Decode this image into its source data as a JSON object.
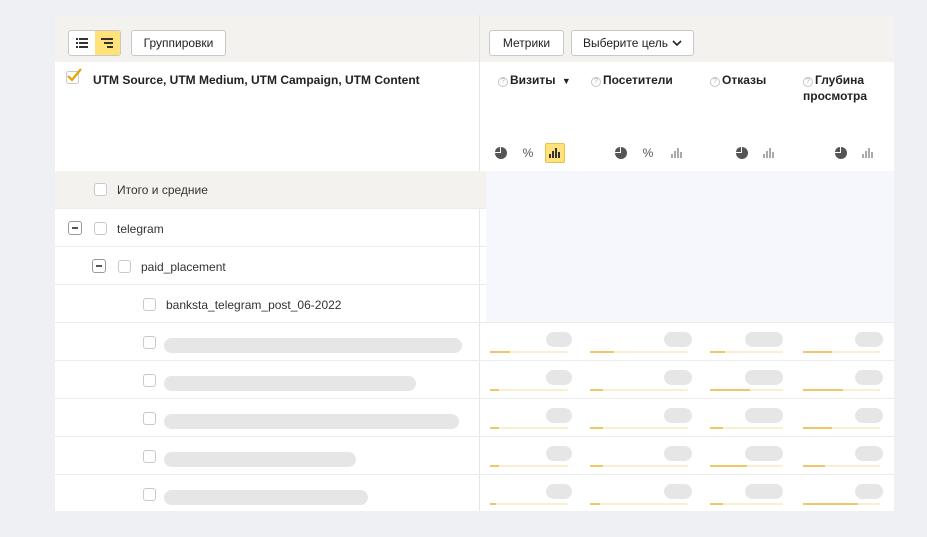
{
  "toolbar": {
    "groupings_label": "Группировки",
    "metrics_label": "Метрики",
    "goal_label": "Выберите цель"
  },
  "dimensions_header": "UTM Source, UTM Medium, UTM Campaign, UTM Content",
  "metrics": [
    {
      "label": "Визиты",
      "sort": "▼"
    },
    {
      "label": "Посетители"
    },
    {
      "label": "Отказы"
    },
    {
      "label": "Глубина просмотра"
    }
  ],
  "mini_icons": {
    "percent": "%"
  },
  "rows": {
    "totals": "Итого и средние",
    "source": "telegram",
    "medium": "paid_placement",
    "campaign": "banksta_telegram_post_06-2022"
  },
  "colors": {
    "accent": "#ffe27a",
    "bar_fill": "#f0c66a",
    "bar_track": "#fbefd2"
  },
  "loading_rows": [
    {
      "name_width": 0.98,
      "bars": [
        0.25,
        0.24,
        0.2,
        0.38
      ]
    },
    {
      "name_width": 0.83,
      "bars": [
        0.12,
        0.13,
        0.55,
        0.52
      ]
    },
    {
      "name_width": 0.97,
      "bars": [
        0.12,
        0.13,
        0.18,
        0.38
      ]
    },
    {
      "name_width": 0.63,
      "bars": [
        0.12,
        0.13,
        0.5,
        0.29
      ]
    },
    {
      "name_width": 0.67,
      "bars": [
        0.08,
        0.1,
        0.18,
        0.72
      ]
    }
  ]
}
